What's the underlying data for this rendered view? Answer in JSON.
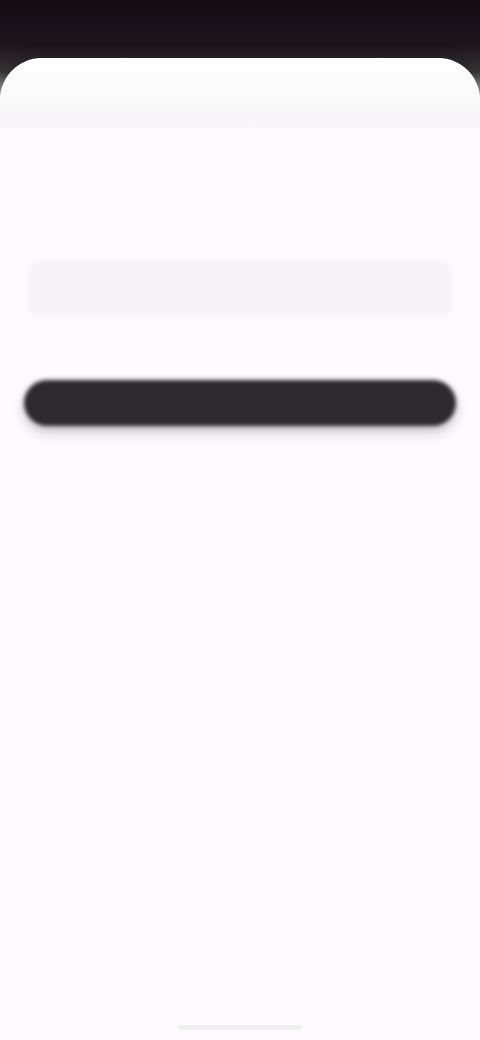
{
  "status_bar": {
    "time": "",
    "indicators": ""
  },
  "header": {
    "back_icon": "chevron-left-icon",
    "back_glyph": ""
  },
  "main": {
    "title": "",
    "field": {
      "label": "",
      "value": "",
      "placeholder": ""
    },
    "primary_button_label": ""
  },
  "colors": {
    "status_bar_background": "#140d14",
    "sheet_background": "#fdfbfd",
    "input_background": "#f6f4f6",
    "button_background": "#2c2a2e"
  }
}
